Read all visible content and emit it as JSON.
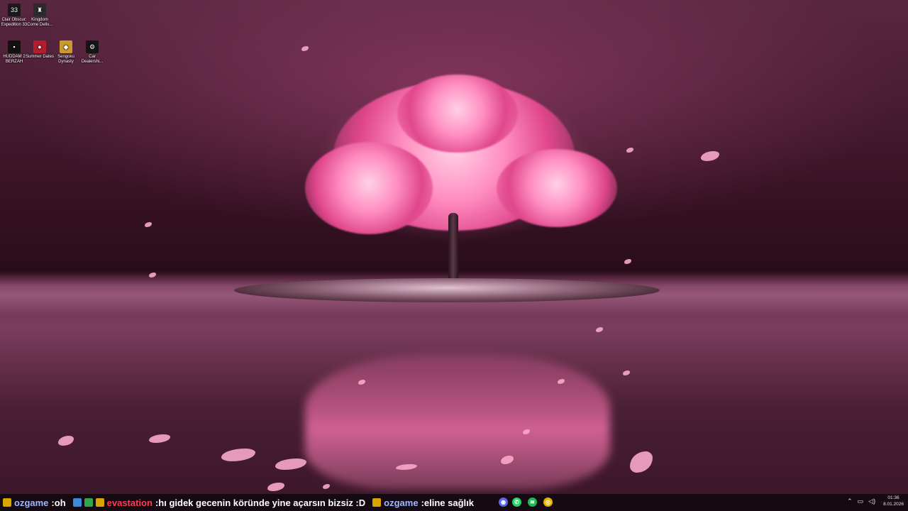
{
  "desktop_icons": [
    {
      "label": "Clair Obscur: Expedition 33",
      "glyph": "33",
      "color": "#1a1a1a",
      "icon": "clair-obscur-icon"
    },
    {
      "label": "Kingdom Come Deliv...",
      "glyph": "♜",
      "color": "#2b2b2b",
      "icon": "kingdom-come-icon"
    },
    {
      "label": "HUDDAM 2 BERZAH",
      "glyph": "▪",
      "color": "#111111",
      "icon": "huddam-icon"
    },
    {
      "label": "Summer Dates",
      "glyph": "●",
      "color": "#b21e2e",
      "icon": "summer-dates-icon"
    },
    {
      "label": "Sengoku Dynasty",
      "glyph": "◆",
      "color": "#c99a2e",
      "icon": "sengoku-dynasty-icon"
    },
    {
      "label": "Car Dealershi...",
      "glyph": "⚙",
      "color": "#151515",
      "icon": "car-dealership-icon"
    }
  ],
  "chat": {
    "messages": [
      {
        "user": "ozgame",
        "separator": " : ",
        "text": "oh",
        "user_color": "#9fb8ff"
      },
      {
        "user": "evastation",
        "separator": " : ",
        "text": "hı gidek gecenin köründe yine açarsın bizsiz :D",
        "user_color": "#ff3b55"
      },
      {
        "user": "ozgame",
        "separator": " : ",
        "text": "eline sağlık",
        "user_color": "#9fb8ff"
      }
    ]
  },
  "taskbar_apps": [
    {
      "name": "discord-icon",
      "glyph": "◉",
      "color": "#5865f2"
    },
    {
      "name": "whatsapp-icon",
      "glyph": "✆",
      "color": "#25d366"
    },
    {
      "name": "spotify-icon",
      "glyph": "≋",
      "color": "#1db954"
    },
    {
      "name": "chrome-icon",
      "glyph": "◎",
      "color": "#e8b300"
    }
  ],
  "tray": {
    "icons": [
      "chevron-up-icon",
      "network-icon",
      "volume-icon"
    ],
    "time": "01:36",
    "date": "8.01.2026"
  }
}
